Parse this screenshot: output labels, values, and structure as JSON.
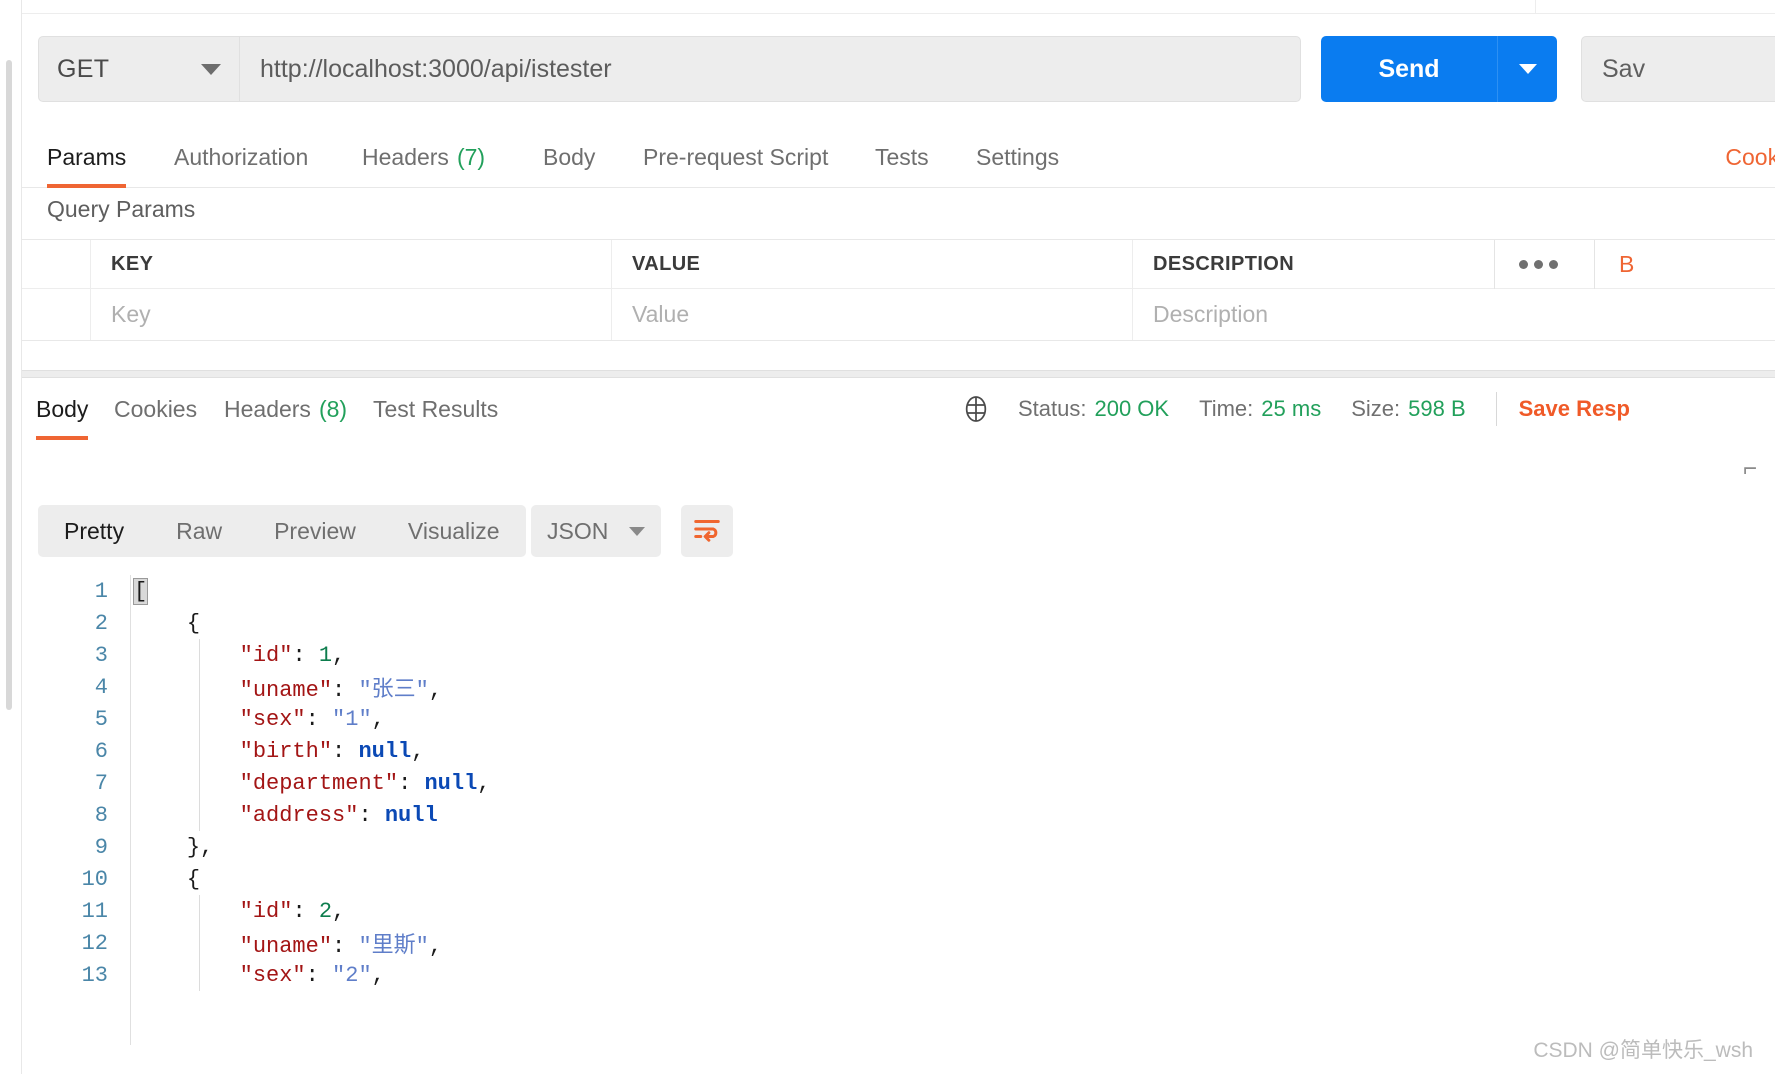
{
  "request": {
    "method": "GET",
    "url": "http://localhost:3000/api/istester",
    "send_label": "Send",
    "save_label": "Sav",
    "tabs": [
      {
        "label": "Params",
        "count": "",
        "active": true
      },
      {
        "label": "Authorization",
        "count": "",
        "active": false
      },
      {
        "label": "Headers",
        "count": "(7)",
        "active": false
      },
      {
        "label": "Body",
        "count": "",
        "active": false
      },
      {
        "label": "Pre-request Script",
        "count": "",
        "active": false
      },
      {
        "label": "Tests",
        "count": "",
        "active": false
      },
      {
        "label": "Settings",
        "count": "",
        "active": false
      }
    ],
    "cookies_link": "Cookie"
  },
  "query_params": {
    "title": "Query Params",
    "columns": [
      "KEY",
      "VALUE",
      "DESCRIPTION"
    ],
    "rows": [
      {
        "key": "Key",
        "value": "Value",
        "description": "Description"
      }
    ],
    "more_icon": "ellipsis-icon",
    "bulk_edit_label": "B"
  },
  "response": {
    "tabs": [
      {
        "label": "Body",
        "count": "",
        "active": true
      },
      {
        "label": "Cookies",
        "count": "",
        "active": false
      },
      {
        "label": "Headers",
        "count": "(8)",
        "active": false
      },
      {
        "label": "Test Results",
        "count": "",
        "active": false
      }
    ],
    "status_label": "Status:",
    "status_value": "200 OK",
    "time_label": "Time:",
    "time_value": "25 ms",
    "size_label": "Size:",
    "size_value": "598 B",
    "save_response_label": "Save Resp",
    "globe_icon": "globe-icon",
    "format_buttons": [
      {
        "label": "Pretty",
        "active": true
      },
      {
        "label": "Raw",
        "active": false
      },
      {
        "label": "Preview",
        "active": false
      },
      {
        "label": "Visualize",
        "active": false
      }
    ],
    "language": "JSON",
    "wrap_icon": "word-wrap-icon"
  },
  "body_code": {
    "lines": [
      {
        "n": "1",
        "indent": 0,
        "tokens": [
          {
            "t": "[",
            "c": "punc hl"
          }
        ]
      },
      {
        "n": "2",
        "indent": 1,
        "tokens": [
          {
            "t": "{",
            "c": "punc"
          }
        ]
      },
      {
        "n": "3",
        "indent": 2,
        "tokens": [
          {
            "t": "\"id\"",
            "c": "key"
          },
          {
            "t": ": ",
            "c": "punc"
          },
          {
            "t": "1",
            "c": "num"
          },
          {
            "t": ",",
            "c": "punc"
          }
        ]
      },
      {
        "n": "4",
        "indent": 2,
        "tokens": [
          {
            "t": "\"uname\"",
            "c": "key"
          },
          {
            "t": ": ",
            "c": "punc"
          },
          {
            "t": "\"张三\"",
            "c": "str"
          },
          {
            "t": ",",
            "c": "punc"
          }
        ]
      },
      {
        "n": "5",
        "indent": 2,
        "tokens": [
          {
            "t": "\"sex\"",
            "c": "key"
          },
          {
            "t": ": ",
            "c": "punc"
          },
          {
            "t": "\"1\"",
            "c": "str"
          },
          {
            "t": ",",
            "c": "punc"
          }
        ]
      },
      {
        "n": "6",
        "indent": 2,
        "tokens": [
          {
            "t": "\"birth\"",
            "c": "key"
          },
          {
            "t": ": ",
            "c": "punc"
          },
          {
            "t": "null",
            "c": "null"
          },
          {
            "t": ",",
            "c": "punc"
          }
        ]
      },
      {
        "n": "7",
        "indent": 2,
        "tokens": [
          {
            "t": "\"department\"",
            "c": "key"
          },
          {
            "t": ": ",
            "c": "punc"
          },
          {
            "t": "null",
            "c": "null"
          },
          {
            "t": ",",
            "c": "punc"
          }
        ]
      },
      {
        "n": "8",
        "indent": 2,
        "tokens": [
          {
            "t": "\"address\"",
            "c": "key"
          },
          {
            "t": ": ",
            "c": "punc"
          },
          {
            "t": "null",
            "c": "null"
          }
        ]
      },
      {
        "n": "9",
        "indent": 1,
        "tokens": [
          {
            "t": "},",
            "c": "punc"
          }
        ]
      },
      {
        "n": "10",
        "indent": 1,
        "tokens": [
          {
            "t": "{",
            "c": "punc"
          }
        ]
      },
      {
        "n": "11",
        "indent": 2,
        "tokens": [
          {
            "t": "\"id\"",
            "c": "key"
          },
          {
            "t": ": ",
            "c": "punc"
          },
          {
            "t": "2",
            "c": "num"
          },
          {
            "t": ",",
            "c": "punc"
          }
        ]
      },
      {
        "n": "12",
        "indent": 2,
        "tokens": [
          {
            "t": "\"uname\"",
            "c": "key"
          },
          {
            "t": ": ",
            "c": "punc"
          },
          {
            "t": "\"里斯\"",
            "c": "str"
          },
          {
            "t": ",",
            "c": "punc"
          }
        ]
      },
      {
        "n": "13",
        "indent": 2,
        "tokens": [
          {
            "t": "\"sex\"",
            "c": "key"
          },
          {
            "t": ": ",
            "c": "punc"
          },
          {
            "t": "\"2\"",
            "c": "str"
          },
          {
            "t": ",",
            "c": "punc"
          }
        ]
      }
    ]
  },
  "watermark": "CSDN @简单快乐_wsh",
  "colors": {
    "accent_orange": "#ef6533",
    "send_blue": "#0a7cf0",
    "status_green": "#22a05b"
  }
}
